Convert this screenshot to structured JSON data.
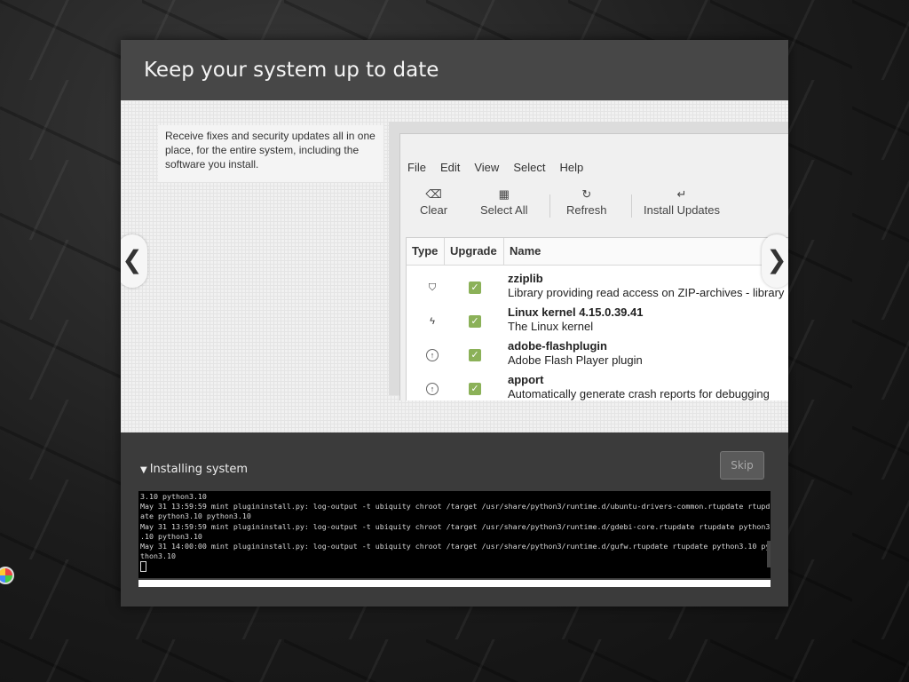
{
  "header": {
    "title": "Keep your system up to date"
  },
  "slide": {
    "description": "Receive fixes and security updates all in one place, for the entire system, including the software you install.",
    "prev_arrow": "❮",
    "next_arrow": "❯",
    "window": {
      "menu": [
        "File",
        "Edit",
        "View",
        "Select",
        "Help"
      ],
      "toolbar": [
        {
          "icon": "backspace-icon",
          "glyph": "⌫",
          "label": "Clear"
        },
        {
          "icon": "select-all-icon",
          "glyph": "▦",
          "label": "Select All"
        },
        {
          "icon": "refresh-icon",
          "glyph": "↻",
          "label": "Refresh"
        },
        {
          "icon": "enter-icon",
          "glyph": "↵",
          "label": "Install Updates"
        }
      ],
      "columns": [
        "Type",
        "Upgrade",
        "Name"
      ],
      "rows": [
        {
          "type_icon": "shield-icon",
          "type_glyph": "⛉",
          "checked": true,
          "name": "zziplib",
          "desc": "Library providing read access on ZIP-archives - library"
        },
        {
          "type_icon": "kernel-bolt-icon",
          "type_glyph": "ϟ",
          "checked": true,
          "name": "Linux kernel 4.15.0.39.41",
          "desc": "The Linux kernel"
        },
        {
          "type_icon": "upgrade-arrow-icon",
          "type_glyph": "↑",
          "checked": true,
          "name": "adobe-flashplugin",
          "desc": "Adobe Flash Player plugin"
        },
        {
          "type_icon": "upgrade-arrow-icon",
          "type_glyph": "↑",
          "checked": true,
          "name": "apport",
          "desc": "Automatically generate crash reports for debugging"
        }
      ]
    }
  },
  "progress": {
    "expander_label": "Installing system",
    "skip_label": "Skip",
    "fraction": 1.0,
    "log": [
      "3.10 python3.10",
      "May 31 13:59:59 mint plugininstall.py: log-output -t ubiquity chroot /target /usr/share/python3/runtime.d/ubuntu-drivers-common.rtupdate rtupd",
      "ate python3.10 python3.10",
      "May 31 13:59:59 mint plugininstall.py: log-output -t ubiquity chroot /target /usr/share/python3/runtime.d/gdebi-core.rtupdate rtupdate python3",
      ".10 python3.10",
      "May 31 14:00:00 mint plugininstall.py: log-output -t ubiquity chroot /target /usr/share/python3/runtime.d/gufw.rtupdate rtupdate python3.10 py",
      "thon3.10"
    ]
  }
}
